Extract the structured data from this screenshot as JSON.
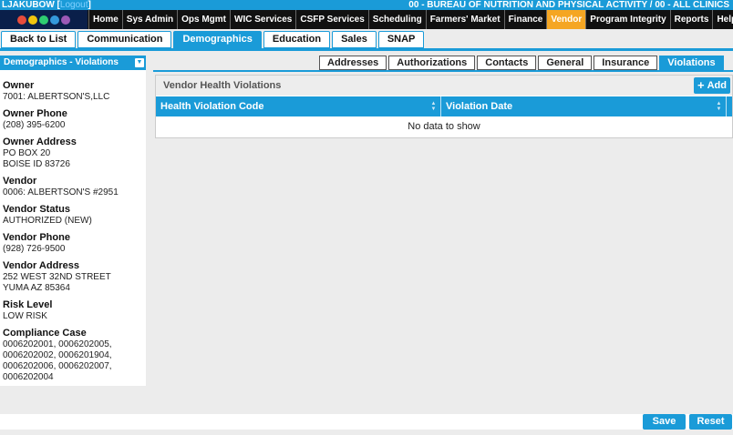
{
  "header": {
    "user": "LJAKUBOW [",
    "user_link": "Logout",
    "user_close": "]",
    "clinic": "00 - BUREAU OF NUTRITION AND PHYSICAL ACTIVITY / 00 - ALL CLINICS"
  },
  "nav": {
    "items": [
      "Home",
      "Sys Admin",
      "Ops Mgmt",
      "WIC Services",
      "CSFP Services",
      "Scheduling",
      "Farmers' Market",
      "Finance",
      "Vendor",
      "Program Integrity",
      "Reports",
      "Help"
    ],
    "active": "Vendor"
  },
  "tabs_main": {
    "items": [
      "Back to List",
      "Communication",
      "Demographics",
      "Education",
      "Sales",
      "SNAP"
    ],
    "active": "Demographics"
  },
  "sidebar": {
    "title": "Demographics - Violations",
    "fields": [
      {
        "label": "Owner",
        "value": "7001: ALBERTSON'S,LLC"
      },
      {
        "label": "Owner Phone",
        "value": "(208) 395-6200"
      },
      {
        "label": "Owner Address",
        "value": "PO BOX 20\nBOISE ID 83726"
      },
      {
        "label": "Vendor",
        "value": "0006: ALBERTSON'S #2951"
      },
      {
        "label": "Vendor Status",
        "value": "AUTHORIZED (NEW)"
      },
      {
        "label": "Vendor Phone",
        "value": "(928) 726-9500"
      },
      {
        "label": "Vendor Address",
        "value": "252 WEST 32ND STREET\nYUMA AZ 85364"
      },
      {
        "label": "Risk Level",
        "value": "LOW RISK"
      },
      {
        "label": "Compliance Case",
        "value": "0006202001, 0006202005,\n0006202002, 0006201904,\n0006202006, 0006202007,\n0006202004"
      }
    ]
  },
  "tabs_sub": {
    "items": [
      "Addresses",
      "Authorizations",
      "Contacts",
      "General",
      "Insurance",
      "Violations"
    ],
    "active": "Violations"
  },
  "grid": {
    "title": "Vendor Health Violations",
    "add_label": "Add",
    "columns": [
      "Health Violation Code",
      "Violation Date"
    ],
    "empty_text": "No data to show"
  },
  "actions": {
    "save": "Save",
    "reset": "Reset"
  },
  "colors": {
    "accent": "#1a9bd8",
    "nav_active": "#f5a623",
    "nav_bg": "#111111"
  }
}
